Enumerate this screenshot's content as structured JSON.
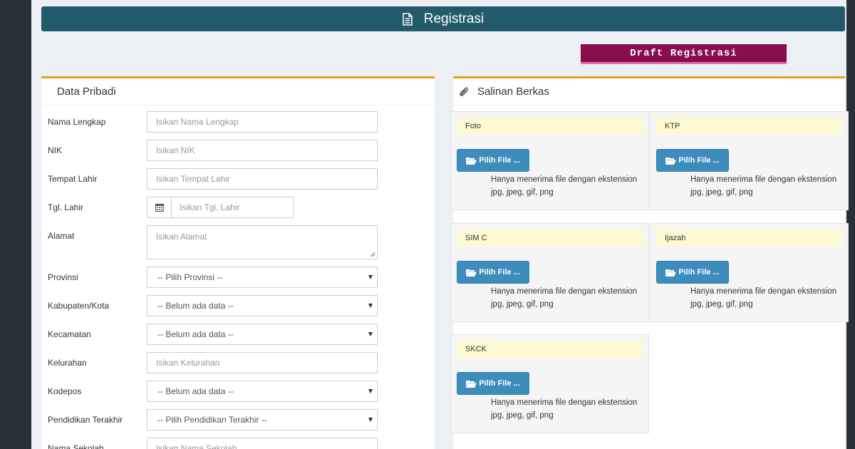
{
  "header": {
    "title": "Registrasi",
    "icon": "document-icon"
  },
  "draft_button": {
    "label": "Draft Registrasi",
    "color": "#880e4f"
  },
  "left_panel": {
    "title": "Data Pribadi",
    "fields": [
      {
        "label": "Nama Lengkap",
        "placeholder": "Isikan Nama Lengkap",
        "type": "text"
      },
      {
        "label": "NIK",
        "placeholder": "Isikan NIK",
        "type": "text"
      },
      {
        "label": "Tempat Lahir",
        "placeholder": "Isikan Tempat Lahir",
        "type": "text"
      },
      {
        "label": "Tgl. Lahir",
        "placeholder": "Isikan Tgl. Lahir",
        "type": "date",
        "icon": "calendar-icon"
      },
      {
        "label": "Alamat",
        "placeholder": "Isikan Alamat",
        "type": "textarea"
      },
      {
        "label": "Provinsi",
        "value": "-- Pilih Provinsi --",
        "type": "select"
      },
      {
        "label": "Kabupaten/Kota",
        "value": "-- Belum ada data --",
        "type": "select"
      },
      {
        "label": "Kecamatan",
        "value": "-- Belum ada data --",
        "type": "select"
      },
      {
        "label": "Kelurahan",
        "placeholder": "Isikan Kelurahan",
        "type": "text"
      },
      {
        "label": "Kodepos",
        "value": "-- Belum ada data --",
        "type": "select"
      },
      {
        "label": "Pendidikan Terakhir",
        "value": "-- Pilih Pendidikan Terakhir --",
        "type": "select"
      },
      {
        "label": "Nama Sekolah",
        "placeholder": "Isikan Nama Sekolah",
        "type": "text"
      }
    ]
  },
  "right_panel": {
    "title": "Salinan Berkas",
    "icon": "paperclip-icon",
    "files": [
      {
        "label": "Foto",
        "button": "Pilih File ...",
        "note": "Hanya menerima file dengan ekstension jpg, jpeg, gif, png"
      },
      {
        "label": "KTP",
        "button": "Pilih File ...",
        "note": "Hanya menerima file dengan ekstension jpg, jpeg, gif, png"
      },
      {
        "label": "SIM C",
        "button": "Pilih File ...",
        "note": "Hanya menerima file dengan ekstension jpg, jpeg, gif, png"
      },
      {
        "label": "Ijazah",
        "button": "Pilih File ...",
        "note": "Hanya menerima file dengan ekstension jpg, jpeg, gif, png"
      },
      {
        "label": "SKCK",
        "button": "Pilih File ...",
        "note": "Hanya menerima file dengan ekstension jpg, jpeg, gif, png"
      }
    ]
  },
  "colors": {
    "header": "#235a6b",
    "panel_accent": "#f39c12",
    "button": "#3c8dbc",
    "file_label_bg": "#fcfad2",
    "sidebar": "#263238"
  }
}
